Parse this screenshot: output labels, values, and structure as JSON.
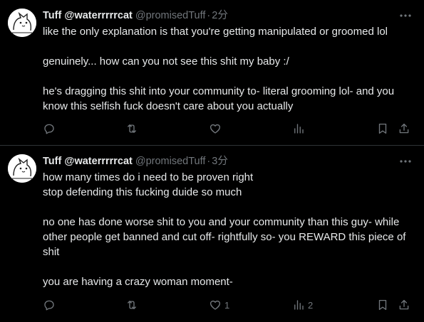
{
  "colors": {
    "background": "#000000",
    "text": "#e7e9ea",
    "muted": "#71767b",
    "divider": "#2f3336"
  },
  "tweets": [
    {
      "display_name": "Tuff @waterrrrrcat",
      "handle": "@promisedTuff",
      "separator": "·",
      "time": "2分",
      "paragraphs": [
        "like the only explanation is that you're getting manipulated or groomed lol",
        "genuinely... how can you not see this shit my baby :/",
        "he's dragging this shit into your community to- literal grooming lol- and you know this selfish fuck doesn't care about you actually"
      ],
      "actions": {
        "reply_icon": "reply-icon",
        "retweet_icon": "retweet-icon",
        "like_icon": "heart-icon",
        "like_count": "",
        "views_icon": "views-icon",
        "views_count": "",
        "bookmark_icon": "bookmark-icon",
        "share_icon": "share-icon"
      }
    },
    {
      "display_name": "Tuff @waterrrrrcat",
      "handle": "@promisedTuff",
      "separator": "·",
      "time": "3分",
      "paragraphs": [
        "how many times do i need to be proven right\nstop defending this fucking duide so much",
        "no one has done worse shit to you and your community than this guy- while other people get banned and cut off- rightfully so- you REWARD this piece of shit",
        "you are having a crazy woman moment-"
      ],
      "actions": {
        "reply_icon": "reply-icon",
        "retweet_icon": "retweet-icon",
        "like_icon": "heart-icon",
        "like_count": "1",
        "views_icon": "views-icon",
        "views_count": "2",
        "bookmark_icon": "bookmark-icon",
        "share_icon": "share-icon"
      }
    }
  ]
}
